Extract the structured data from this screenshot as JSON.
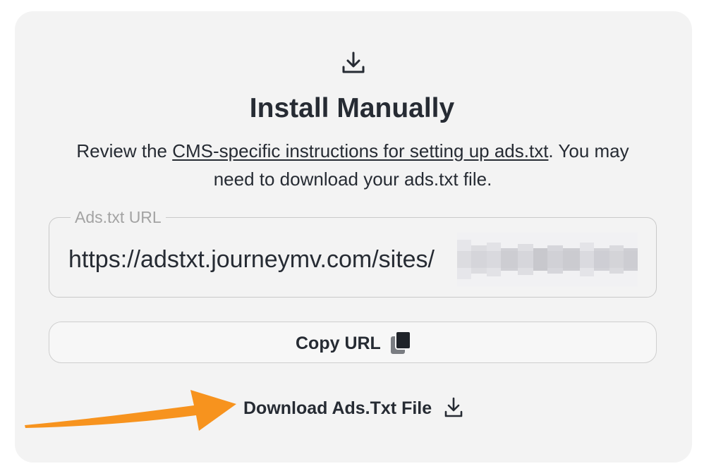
{
  "panel": {
    "title": "Install Manually",
    "description_before": "Review the ",
    "description_link": "CMS-specific instructions for setting up ads.txt",
    "description_after": ". You may need to download your ads.txt file."
  },
  "url_field": {
    "label": "Ads.txt URL",
    "value": "https://adstxt.journeymv.com/sites/"
  },
  "copy_button": {
    "label": "Copy URL",
    "icon": "copy-icon"
  },
  "download_link": {
    "label": "Download Ads.Txt File",
    "icon": "download-icon"
  },
  "colors": {
    "card_background": "#f3f3f3",
    "text": "#262b33",
    "muted_label": "#a3a3a3",
    "annotation_arrow": "#f7931e"
  }
}
